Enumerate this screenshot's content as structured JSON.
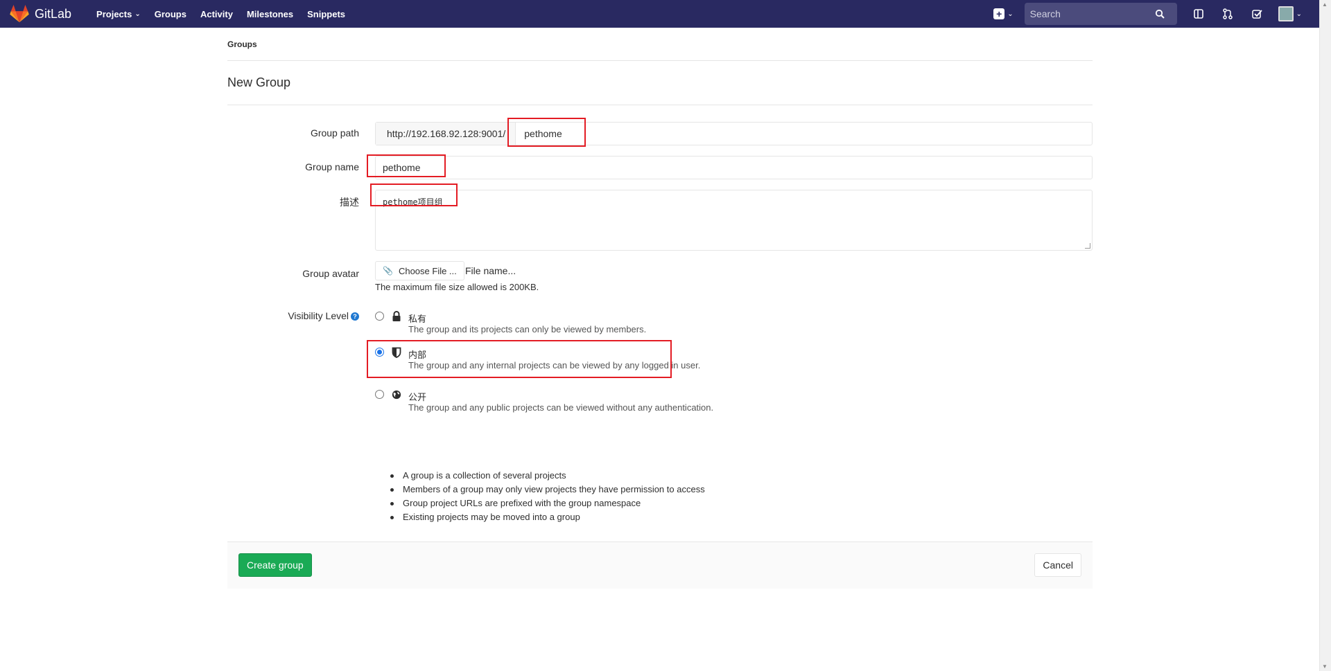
{
  "navbar": {
    "brand": "GitLab",
    "links": [
      "Projects",
      "Groups",
      "Activity",
      "Milestones",
      "Snippets"
    ],
    "search_placeholder": "Search",
    "bg_color": "#292961"
  },
  "breadcrumb": "Groups",
  "page_title": "New Group",
  "form": {
    "group_path_label": "Group path",
    "group_path_prefix": "http://192.168.92.128:9001/",
    "group_path_value": "pethome",
    "group_name_label": "Group name",
    "group_name_value": "pethome",
    "description_label": "描述",
    "description_value": "pethome项目组",
    "avatar_label": "Group avatar",
    "choose_file_label": "Choose File ...",
    "file_name": "File name...",
    "max_size_note": "The maximum file size allowed is 200KB.",
    "visibility_label": "Visibility Level",
    "visibility_options": [
      {
        "title": "私有",
        "desc": "The group and its projects can only be viewed by members.",
        "icon": "lock-icon",
        "checked": false
      },
      {
        "title": "内部",
        "desc": "The group and any internal projects can be viewed by any logged in user.",
        "icon": "shield-icon",
        "checked": true
      },
      {
        "title": "公开",
        "desc": "The group and any public projects can be viewed without any authentication.",
        "icon": "globe-icon",
        "checked": false
      }
    ],
    "notes": [
      "A group is a collection of several projects",
      "Members of a group may only view projects they have permission to access",
      "Group project URLs are prefixed with the group namespace",
      "Existing projects may be moved into a group"
    ]
  },
  "actions": {
    "create_label": "Create group",
    "cancel_label": "Cancel",
    "create_color": "#1aaa55"
  },
  "highlight_color": "#e31b23"
}
